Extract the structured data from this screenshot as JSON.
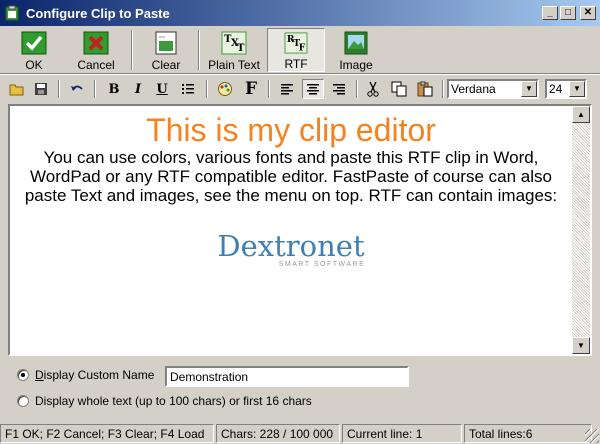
{
  "window": {
    "title": "Configure Clip to Paste",
    "minimize_glyph": "_",
    "maximize_glyph": "□",
    "close_glyph": "✕"
  },
  "main_toolbar": {
    "ok": "OK",
    "cancel": "Cancel",
    "clear": "Clear",
    "plain_text": "Plain Text",
    "rtf": "RTF",
    "image": "Image"
  },
  "format_toolbar": {
    "bold_glyph": "B",
    "italic_glyph": "I",
    "underline_glyph": "U",
    "font_glyph": "F",
    "font_name": "Verdana",
    "font_size": "24"
  },
  "editor": {
    "title": "This is my clip editor",
    "body": "You can use colors, various fonts and paste this RTF clip in Word, WordPad or any RTF compatible editor. FastPaste of course can also paste Text and images, see the menu on top. RTF can contain images:",
    "logo_name": "Dextronet",
    "logo_tagline": "SMART SOFTWARE"
  },
  "options": {
    "custom_name_label": "Display Custom Name",
    "custom_name_value": "Demonstration",
    "whole_text_label": "Display whole text (up to 100 chars) or first 16 chars",
    "selected": "custom_name"
  },
  "status": {
    "shortcuts": "F1 OK; F2 Cancel; F3 Clear; F4 Load",
    "chars": "Chars: 228 / 100 000",
    "current_line": "Current line: 1",
    "total_lines": "Total lines:6"
  },
  "colors": {
    "title_gradient_start": "#0a246a",
    "title_gradient_end": "#a6caf0",
    "editor_title": "#f5811f",
    "logo": "#3f7fb4",
    "ok_green": "#2e9d2e",
    "cancel_red": "#c81e1e"
  }
}
